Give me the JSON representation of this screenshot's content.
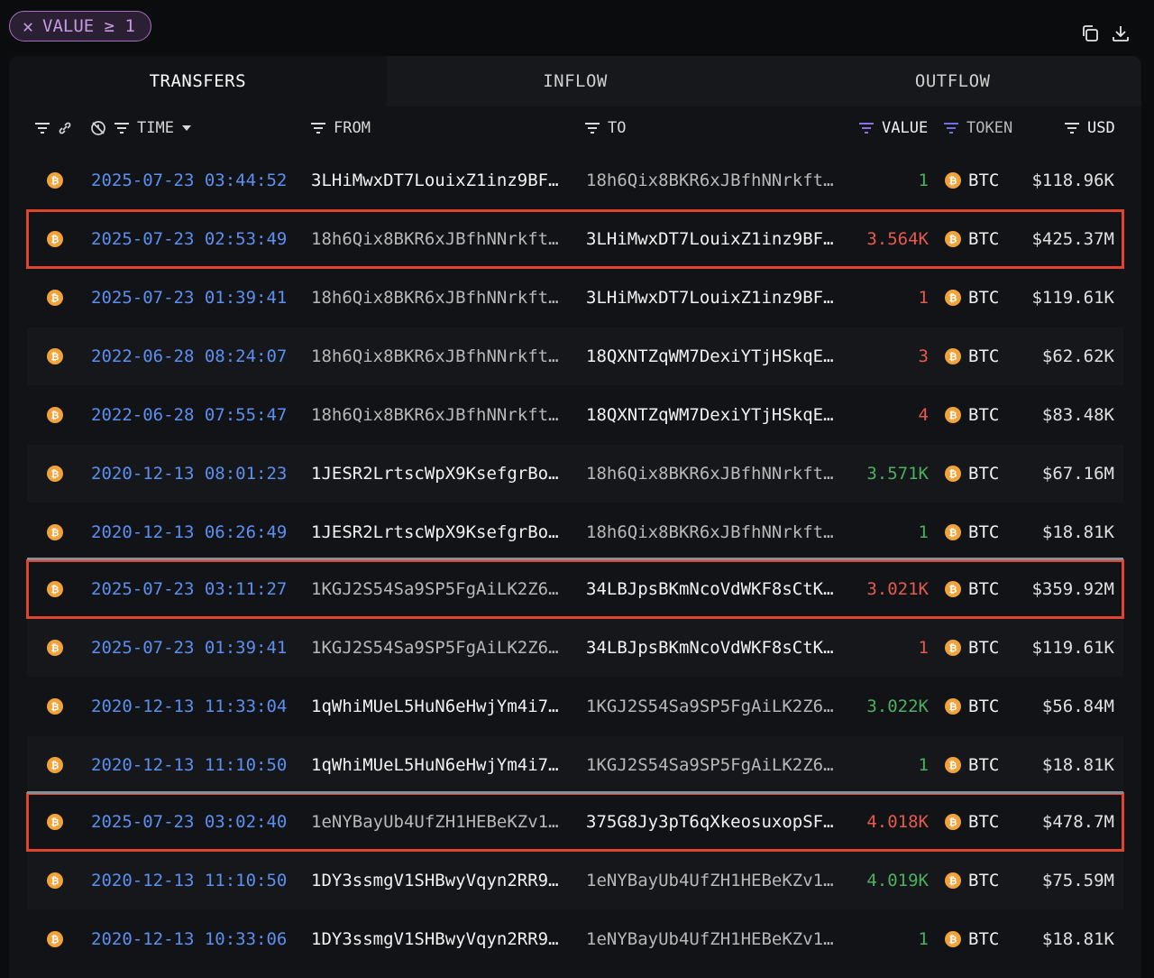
{
  "filter": {
    "label": "VALUE ≥ 1",
    "close_glyph": "✕"
  },
  "toolbar": {
    "copy_icon": "copy-icon",
    "download_icon": "download-icon"
  },
  "tabs": [
    {
      "label": "TRANSFERS",
      "active": true
    },
    {
      "label": "INFLOW",
      "active": false
    },
    {
      "label": "OUTFLOW",
      "active": false
    }
  ],
  "columns": {
    "time": "TIME",
    "from": "FROM",
    "to": "TO",
    "value": "VALUE",
    "token": "TOKEN",
    "usd": "USD"
  },
  "colors": {
    "time": "#5b8ff0",
    "inflow": "#4bb05f",
    "outflow": "#e55a4e",
    "highlight": "#e0442d",
    "coin": "#f1a33b"
  },
  "rows": [
    {
      "time": "2025-07-23 03:44:52",
      "from": "3LHiMwxDT7LouixZ1inz9BF…",
      "to": "18h6Qix8BKR6xJBfhNNrkft…",
      "value": "1",
      "dir": "in",
      "token": "BTC",
      "usd": "$118.96K",
      "highlight": false,
      "from_bright": true,
      "to_bright": false
    },
    {
      "time": "2025-07-23 02:53:49",
      "from": "18h6Qix8BKR6xJBfhNNrkft…",
      "to": "3LHiMwxDT7LouixZ1inz9BF…",
      "value": "3.564K",
      "dir": "out",
      "token": "BTC",
      "usd": "$425.37M",
      "highlight": true,
      "from_bright": false,
      "to_bright": true
    },
    {
      "time": "2025-07-23 01:39:41",
      "from": "18h6Qix8BKR6xJBfhNNrkft…",
      "to": "3LHiMwxDT7LouixZ1inz9BF…",
      "value": "1",
      "dir": "out",
      "token": "BTC",
      "usd": "$119.61K",
      "highlight": false,
      "from_bright": false,
      "to_bright": true
    },
    {
      "time": "2022-06-28 08:24:07",
      "from": "18h6Qix8BKR6xJBfhNNrkft…",
      "to": "18QXNTZqWM7DexiYTjHSkqE…",
      "value": "3",
      "dir": "out",
      "token": "BTC",
      "usd": "$62.62K",
      "highlight": false,
      "from_bright": false,
      "to_bright": true
    },
    {
      "time": "2022-06-28 07:55:47",
      "from": "18h6Qix8BKR6xJBfhNNrkft…",
      "to": "18QXNTZqWM7DexiYTjHSkqE…",
      "value": "4",
      "dir": "out",
      "token": "BTC",
      "usd": "$83.48K",
      "highlight": false,
      "from_bright": false,
      "to_bright": true
    },
    {
      "time": "2020-12-13 08:01:23",
      "from": "1JESR2LrtscWpX9KsefgrBo…",
      "to": "18h6Qix8BKR6xJBfhNNrkft…",
      "value": "3.571K",
      "dir": "in",
      "token": "BTC",
      "usd": "$67.16M",
      "highlight": false,
      "from_bright": true,
      "to_bright": false
    },
    {
      "time": "2020-12-13 06:26:49",
      "from": "1JESR2LrtscWpX9KsefgrBo…",
      "to": "18h6Qix8BKR6xJBfhNNrkft…",
      "value": "1",
      "dir": "in",
      "token": "BTC",
      "usd": "$18.81K",
      "highlight": false,
      "from_bright": true,
      "to_bright": false
    },
    {
      "time": "2025-07-23 03:11:27",
      "from": "1KGJ2S54Sa9SP5FgAiLK2Z6…",
      "to": "34LBJpsBKmNcoVdWKF8sCtK…",
      "value": "3.021K",
      "dir": "out",
      "token": "BTC",
      "usd": "$359.92M",
      "highlight": true,
      "from_bright": false,
      "to_bright": true
    },
    {
      "time": "2025-07-23 01:39:41",
      "from": "1KGJ2S54Sa9SP5FgAiLK2Z6…",
      "to": "34LBJpsBKmNcoVdWKF8sCtK…",
      "value": "1",
      "dir": "out",
      "token": "BTC",
      "usd": "$119.61K",
      "highlight": false,
      "from_bright": false,
      "to_bright": true
    },
    {
      "time": "2020-12-13 11:33:04",
      "from": "1qWhiMUeL5HuN6eHwjYm4i7…",
      "to": "1KGJ2S54Sa9SP5FgAiLK2Z6…",
      "value": "3.022K",
      "dir": "in",
      "token": "BTC",
      "usd": "$56.84M",
      "highlight": false,
      "from_bright": true,
      "to_bright": false
    },
    {
      "time": "2020-12-13 11:10:50",
      "from": "1qWhiMUeL5HuN6eHwjYm4i7…",
      "to": "1KGJ2S54Sa9SP5FgAiLK2Z6…",
      "value": "1",
      "dir": "in",
      "token": "BTC",
      "usd": "$18.81K",
      "highlight": false,
      "from_bright": true,
      "to_bright": false
    },
    {
      "time": "2025-07-23 03:02:40",
      "from": "1eNYBayUb4UfZH1HEBeKZv1…",
      "to": "375G8Jy3pT6qXkeosuxopSF…",
      "value": "4.018K",
      "dir": "out",
      "token": "BTC",
      "usd": "$478.7M",
      "highlight": true,
      "from_bright": false,
      "to_bright": true
    },
    {
      "time": "2020-12-13 11:10:50",
      "from": "1DY3ssmgV1SHBwyVqyn2RR9…",
      "to": "1eNYBayUb4UfZH1HEBeKZv1…",
      "value": "4.019K",
      "dir": "in",
      "token": "BTC",
      "usd": "$75.59M",
      "highlight": false,
      "from_bright": true,
      "to_bright": false
    },
    {
      "time": "2020-12-13 10:33:06",
      "from": "1DY3ssmgV1SHBwyVqyn2RR9…",
      "to": "1eNYBayUb4UfZH1HEBeKZv1…",
      "value": "1",
      "dir": "in",
      "token": "BTC",
      "usd": "$18.81K",
      "highlight": false,
      "from_bright": true,
      "to_bright": false
    }
  ]
}
